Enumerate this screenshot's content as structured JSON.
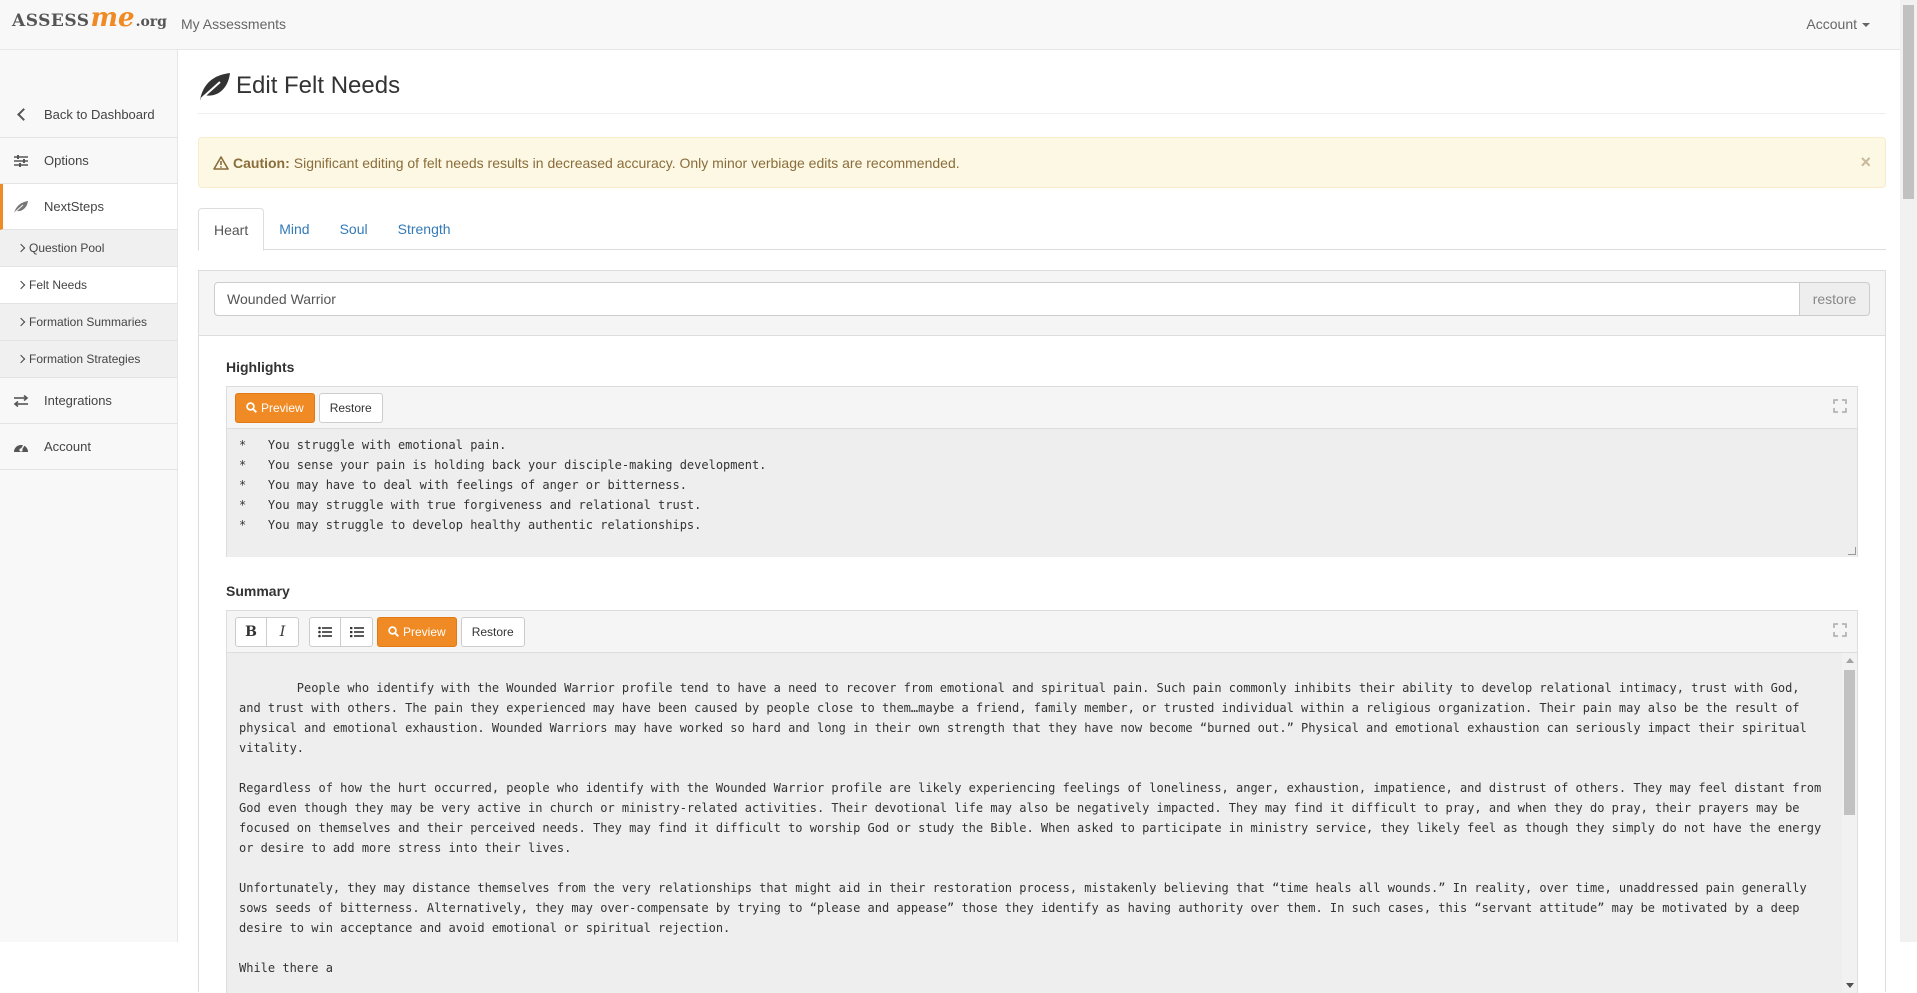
{
  "navbar": {
    "logo_prefix": "ASSESS",
    "logo_me": "me",
    "logo_suffix": ".org",
    "my_assessments": "My Assessments",
    "account": "Account"
  },
  "sidebar": {
    "back": "Back to Dashboard",
    "options": "Options",
    "nextsteps": "NextSteps",
    "sub_items": [
      "Question Pool",
      "Felt Needs",
      "Formation Summaries",
      "Formation Strategies"
    ],
    "integrations": "Integrations",
    "account": "Account"
  },
  "page": {
    "title": "Edit Felt Needs"
  },
  "alert": {
    "strong": "Caution:",
    "text": "Significant editing of felt needs results in decreased accuracy. Only minor verbiage edits are recommended.",
    "close": "×"
  },
  "tabs": [
    "Heart",
    "Mind",
    "Soul",
    "Strength"
  ],
  "profile": {
    "name": "Wounded Warrior",
    "restore": "restore"
  },
  "highlights": {
    "label": "Highlights",
    "preview": "Preview",
    "restore": "Restore",
    "text": "*   You struggle with emotional pain.\n*   You sense your pain is holding back your disciple-making development.\n*   You may have to deal with feelings of anger or bitterness.\n*   You may struggle with true forgiveness and relational trust.\n*   You may struggle to develop healthy authentic relationships."
  },
  "summary": {
    "label": "Summary",
    "bold": "B",
    "italic": "I",
    "preview": "Preview",
    "restore": "Restore",
    "text": "People who identify with the Wounded Warrior profile tend to have a need to recover from emotional and spiritual pain. Such pain commonly inhibits their ability to develop relational intimacy, trust with God, and trust with others. The pain they experienced may have been caused by people close to them…maybe a friend, family member, or trusted individual within a religious organization. Their pain may also be the result of physical and emotional exhaustion. Wounded Warriors may have worked so hard and long in their own strength that they have now become “burned out.” Physical and emotional exhaustion can seriously impact their spiritual vitality.\n\nRegardless of how the hurt occurred, people who identify with the Wounded Warrior profile are likely experiencing feelings of loneliness, anger, exhaustion, impatience, and distrust of others. They may feel distant from God even though they may be very active in church or ministry-related activities. Their devotional life may also be negatively impacted. They may find it difficult to pray, and when they do pray, their prayers may be focused on themselves and their perceived needs. They may find it difficult to worship God or study the Bible. When asked to participate in ministry service, they likely feel as though they simply do not have the energy or desire to add more stress into their lives.\n\nUnfortunately, they may distance themselves from the very relationships that might aid in their restoration process, mistakenly believing that “time heals all wounds.” In reality, over time, unaddressed pain generally sows seeds of bitterness. Alternatively, they may over-compensate by trying to “please and appease” those they identify as having authority over them. In such cases, this “servant attitude” may be motivated by a deep desire to win acceptance and avoid emotional or spiritual rejection.\n\nWhile there a"
  },
  "colors": {
    "accent": "#f08a24",
    "link": "#337ab7",
    "alert_bg": "#fcf8e3",
    "alert_text": "#8a6d3b"
  }
}
